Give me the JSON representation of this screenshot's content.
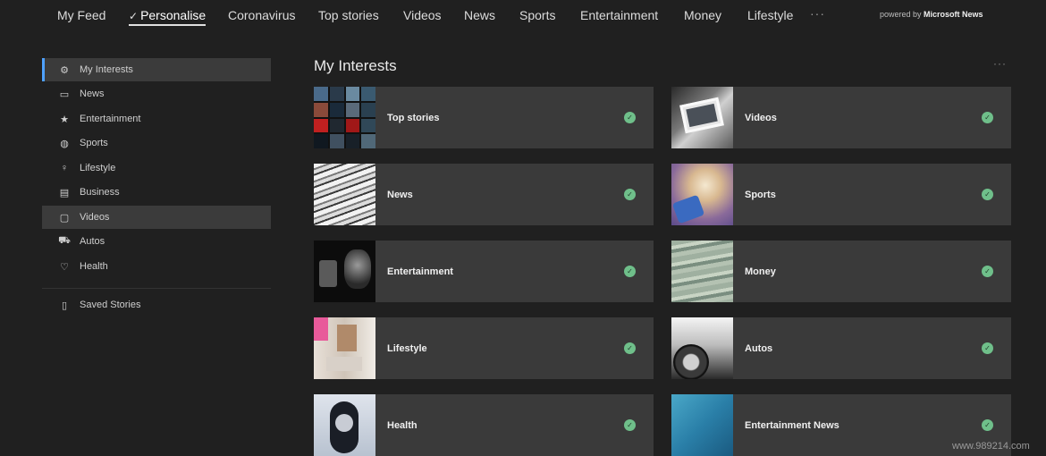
{
  "topnav": {
    "items": [
      {
        "label": "My Feed",
        "active": false
      },
      {
        "label": "Personalise",
        "active": true
      },
      {
        "label": "Coronavirus",
        "active": false
      },
      {
        "label": "Top stories",
        "active": false
      },
      {
        "label": "Videos",
        "active": false
      },
      {
        "label": "News",
        "active": false
      },
      {
        "label": "Sports",
        "active": false
      },
      {
        "label": "Entertainment",
        "active": false
      },
      {
        "label": "Money",
        "active": false
      },
      {
        "label": "Lifestyle",
        "active": false
      }
    ],
    "more": "···",
    "powered_prefix": "powered by",
    "powered_brand": "Microsoft News"
  },
  "sidebar": {
    "items": [
      {
        "label": "My Interests",
        "icon": "gear-icon",
        "state": "selected"
      },
      {
        "label": "News",
        "icon": "newspaper-icon",
        "state": ""
      },
      {
        "label": "Entertainment",
        "icon": "star-icon",
        "state": ""
      },
      {
        "label": "Sports",
        "icon": "ball-icon",
        "state": ""
      },
      {
        "label": "Lifestyle",
        "icon": "lightbulb-icon",
        "state": ""
      },
      {
        "label": "Business",
        "icon": "briefcase-icon",
        "state": ""
      },
      {
        "label": "Videos",
        "icon": "video-icon",
        "state": "hover"
      },
      {
        "label": "Autos",
        "icon": "car-icon",
        "state": ""
      },
      {
        "label": "Health",
        "icon": "heart-icon",
        "state": ""
      }
    ],
    "saved": {
      "label": "Saved Stories",
      "icon": "bookmark-icon"
    }
  },
  "main": {
    "title": "My Interests",
    "more": "···",
    "cards": [
      {
        "label": "Top stories",
        "followed": true
      },
      {
        "label": "Videos",
        "followed": true
      },
      {
        "label": "News",
        "followed": true
      },
      {
        "label": "Sports",
        "followed": true
      },
      {
        "label": "Entertainment",
        "followed": true
      },
      {
        "label": "Money",
        "followed": true
      },
      {
        "label": "Lifestyle",
        "followed": true
      },
      {
        "label": "Autos",
        "followed": true
      },
      {
        "label": "Health",
        "followed": true
      },
      {
        "label": "Entertainment News",
        "followed": true
      }
    ]
  },
  "watermark": "www.989214.com",
  "colors": {
    "accent": "#4ea1ff",
    "check": "#6fbf8a",
    "background": "#202020",
    "card": "#3a3a3a"
  }
}
